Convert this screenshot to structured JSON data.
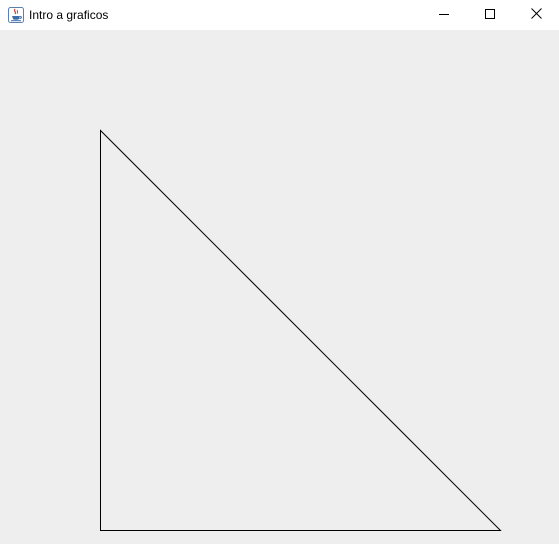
{
  "window": {
    "title": "Intro a graficos",
    "app_icon": "java-cup-icon",
    "controls": {
      "minimize_icon": "minimize-icon",
      "maximize_icon": "maximize-icon",
      "close_icon": "close-icon"
    }
  },
  "canvas": {
    "background": "#eeeeee",
    "shape": {
      "type": "right-triangle",
      "stroke": "#000000",
      "fill": "none"
    }
  }
}
